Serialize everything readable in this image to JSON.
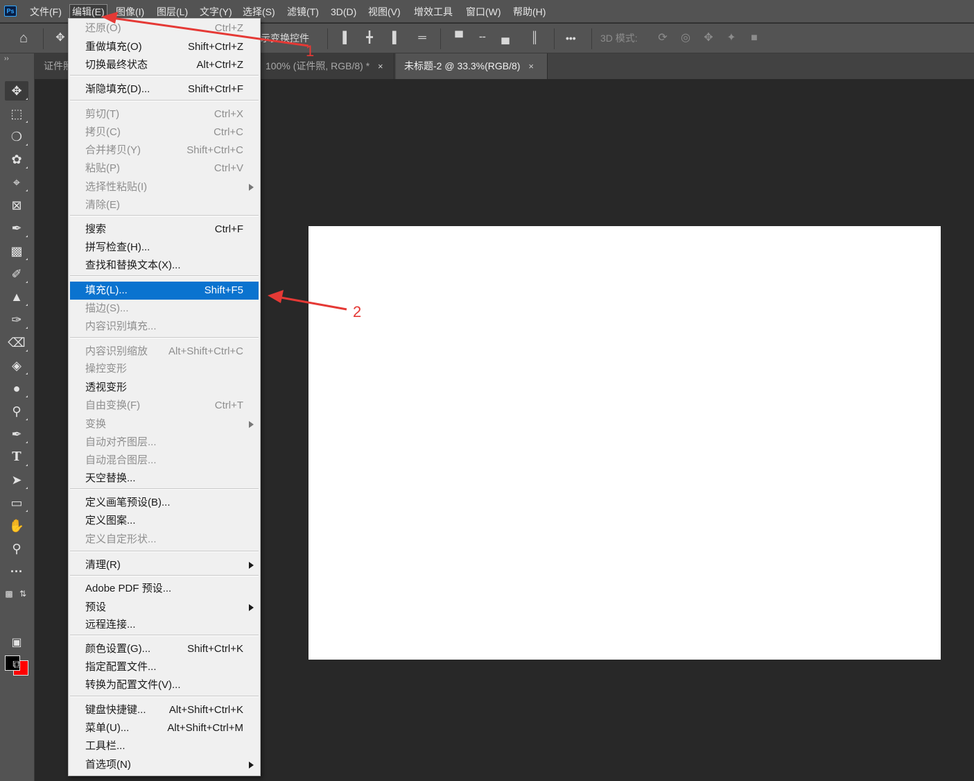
{
  "app": {
    "logo_text": "Ps"
  },
  "menubar": {
    "items": [
      "文件(F)",
      "编辑(E)",
      "图像(I)",
      "图层(L)",
      "文字(Y)",
      "选择(S)",
      "滤镜(T)",
      "3D(D)",
      "视图(V)",
      "增效工具",
      "窗口(W)",
      "帮助(H)"
    ],
    "active": "编辑(E)"
  },
  "options_bar": {
    "transform_label": "示变换控件",
    "more_label": "•••",
    "mode_label": "3D 模式:"
  },
  "tabs": [
    {
      "label": "证件照",
      "active": false
    },
    {
      "label": "100% (证件照, RGB/8) *",
      "active": false
    },
    {
      "label": "未标题-2 @ 33.3%(RGB/8)",
      "active": true
    }
  ],
  "tab_close": "×",
  "toolbar": {
    "collapse": "››",
    "tools": [
      "move-tool",
      "marquee-tool",
      "lasso-tool",
      "quick-select-tool",
      "crop-tool",
      "frame-tool",
      "eyedropper-tool",
      "healing-tool",
      "brush-tool",
      "stamp-tool",
      "history-brush-tool",
      "eraser-tool",
      "paint-bucket-tool",
      "blur-tool",
      "dodge-tool",
      "pen-tool",
      "type-tool",
      "path-select-tool",
      "rectangle-tool",
      "hand-tool",
      "zoom-tool",
      "more-tools"
    ],
    "foreground_color": "#000000",
    "background_color": "#ff0000"
  },
  "edit_menu": {
    "highlighted": "填充(L)...",
    "items": [
      {
        "label": "还原(O)",
        "shortcut": "Ctrl+Z",
        "disabled": true
      },
      {
        "label": "重做填充(O)",
        "shortcut": "Shift+Ctrl+Z",
        "disabled": false
      },
      {
        "label": "切换最终状态",
        "shortcut": "Alt+Ctrl+Z",
        "disabled": false
      },
      {
        "label": "渐隐填充(D)...",
        "shortcut": "Shift+Ctrl+F",
        "disabled": false
      },
      {
        "label": "剪切(T)",
        "shortcut": "Ctrl+X",
        "disabled": true
      },
      {
        "label": "拷贝(C)",
        "shortcut": "Ctrl+C",
        "disabled": true
      },
      {
        "label": "合并拷贝(Y)",
        "shortcut": "Shift+Ctrl+C",
        "disabled": true
      },
      {
        "label": "粘贴(P)",
        "shortcut": "Ctrl+V",
        "disabled": true
      },
      {
        "label": "选择性粘贴(I)",
        "shortcut": "",
        "disabled": true,
        "submenu": true
      },
      {
        "label": "清除(E)",
        "shortcut": "",
        "disabled": true
      },
      {
        "label": "搜索",
        "shortcut": "Ctrl+F",
        "disabled": false
      },
      {
        "label": "拼写检查(H)...",
        "shortcut": "",
        "disabled": false
      },
      {
        "label": "查找和替换文本(X)...",
        "shortcut": "",
        "disabled": false
      },
      {
        "label": "填充(L)...",
        "shortcut": "Shift+F5",
        "disabled": false
      },
      {
        "label": "描边(S)...",
        "shortcut": "",
        "disabled": true
      },
      {
        "label": "内容识别填充...",
        "shortcut": "",
        "disabled": true
      },
      {
        "label": "内容识别缩放",
        "shortcut": "Alt+Shift+Ctrl+C",
        "disabled": true
      },
      {
        "label": "操控变形",
        "shortcut": "",
        "disabled": true
      },
      {
        "label": "透视变形",
        "shortcut": "",
        "disabled": false
      },
      {
        "label": "自由变换(F)",
        "shortcut": "Ctrl+T",
        "disabled": true
      },
      {
        "label": "变换",
        "shortcut": "",
        "disabled": true,
        "submenu": true
      },
      {
        "label": "自动对齐图层...",
        "shortcut": "",
        "disabled": true
      },
      {
        "label": "自动混合图层...",
        "shortcut": "",
        "disabled": true
      },
      {
        "label": "天空替换...",
        "shortcut": "",
        "disabled": false
      },
      {
        "label": "定义画笔预设(B)...",
        "shortcut": "",
        "disabled": false
      },
      {
        "label": "定义图案...",
        "shortcut": "",
        "disabled": false
      },
      {
        "label": "定义自定形状...",
        "shortcut": "",
        "disabled": true
      },
      {
        "label": "清理(R)",
        "shortcut": "",
        "disabled": false,
        "submenu": true
      },
      {
        "label": "Adobe PDF 预设...",
        "shortcut": "",
        "disabled": false
      },
      {
        "label": "预设",
        "shortcut": "",
        "disabled": false,
        "submenu": true
      },
      {
        "label": "远程连接...",
        "shortcut": "",
        "disabled": false
      },
      {
        "label": "颜色设置(G)...",
        "shortcut": "Shift+Ctrl+K",
        "disabled": false
      },
      {
        "label": "指定配置文件...",
        "shortcut": "",
        "disabled": false
      },
      {
        "label": "转换为配置文件(V)...",
        "shortcut": "",
        "disabled": false
      },
      {
        "label": "键盘快捷键...",
        "shortcut": "Alt+Shift+Ctrl+K",
        "disabled": false
      },
      {
        "label": "菜单(U)...",
        "shortcut": "Alt+Shift+Ctrl+M",
        "disabled": false
      },
      {
        "label": "工具栏...",
        "shortcut": "",
        "disabled": false
      },
      {
        "label": "首选项(N)",
        "shortcut": "",
        "disabled": false,
        "submenu": true
      }
    ]
  },
  "annotations": [
    {
      "label": "1",
      "color": "#e53935"
    },
    {
      "label": "2",
      "color": "#e53935"
    }
  ]
}
